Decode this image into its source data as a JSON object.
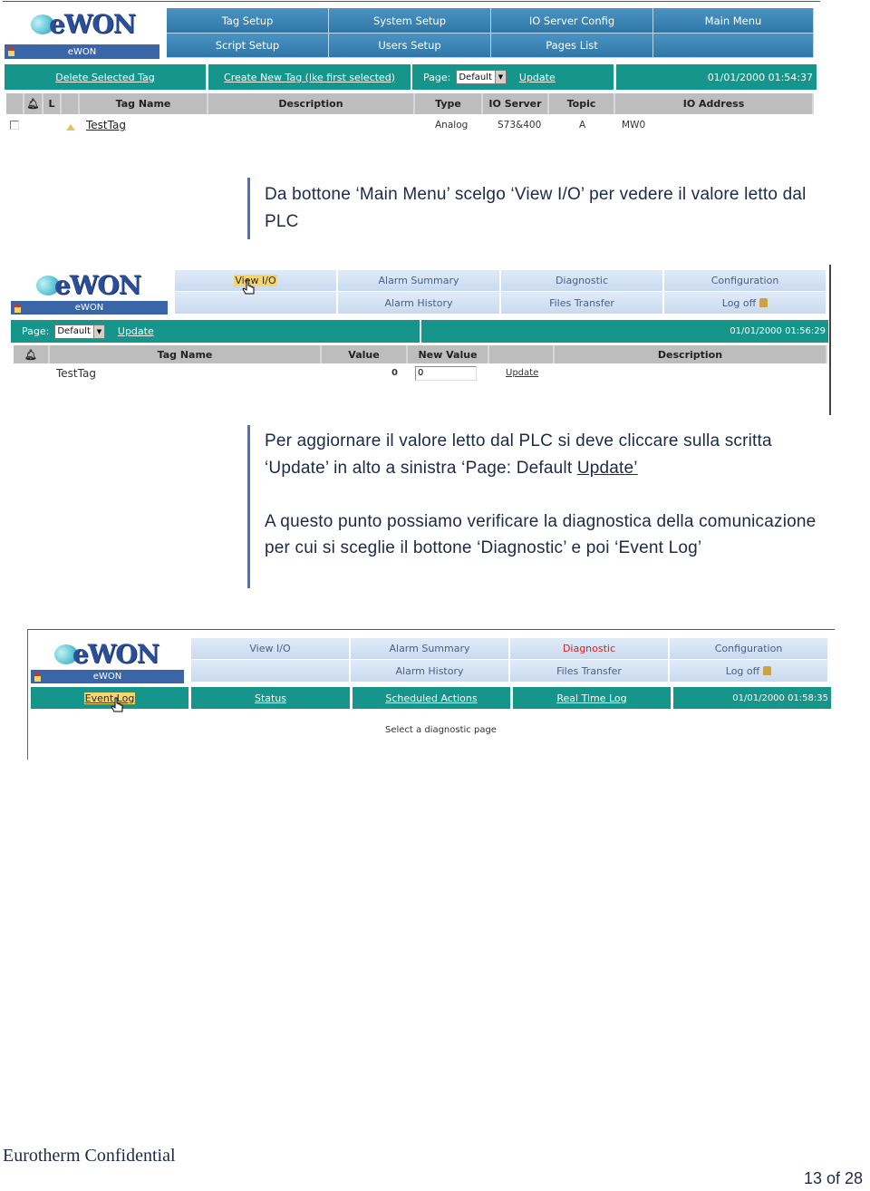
{
  "screenshot1": {
    "logo": "eWON",
    "device_name": "eWON",
    "nav_row1": [
      "Tag Setup",
      "System Setup",
      "IO Server Config",
      "Main Menu"
    ],
    "nav_row2": [
      "Script Setup",
      "Users Setup",
      "Pages List",
      ""
    ],
    "toolbar": {
      "delete_link": "Delete Selected Tag",
      "create_link": "Create New Tag (lke first selected)",
      "page_label": "Page:",
      "page_select": "Default",
      "update_link": "Update",
      "datetime": "01/01/2000 01:54:37"
    },
    "columns": [
      "",
      " ",
      "L",
      "",
      "Tag Name",
      "Description",
      "Type",
      "IO Server",
      "Topic",
      "IO Address"
    ],
    "rows": [
      {
        "tag_name": "TestTag",
        "description": "",
        "type": "Analog",
        "io_server": "S73&400",
        "topic": "A",
        "io_address": "MW0"
      }
    ]
  },
  "callout1": {
    "text": "Da bottone ‘Main Menu’ scelgo ‘View I/O’ per vedere il valore letto dal PLC"
  },
  "screenshot2": {
    "logo": "eWON",
    "device_name": "eWON",
    "nav_row1": [
      "View I/O",
      "Alarm Summary",
      "Diagnostic",
      "Configuration"
    ],
    "nav_row2": [
      "",
      "Alarm History",
      "Files Transfer",
      "Log off"
    ],
    "toolbar": {
      "page_label": "Page:",
      "page_select": "Default",
      "update_link": "Update",
      "datetime": "01/01/2000 01:56:29"
    },
    "columns": [
      "",
      "Tag Name",
      "Value",
      "New Value",
      "",
      "Description"
    ],
    "rows": [
      {
        "tag_name": "TestTag",
        "value": "0",
        "new_value": "0",
        "action": "Update",
        "description": ""
      }
    ]
  },
  "callout2": {
    "line1_a": "Per aggiornare il valore letto dal PLC si deve cliccare sulla scritta ‘Update’ in alto a sinistra ‘Page: Default ",
    "line1_link": "Update’",
    "para2": "A questo punto possiamo verificare la diagnostica della comunicazione per cui si sceglie il bottone ‘Diagnostic’ e poi ‘Event Log’"
  },
  "screenshot3": {
    "logo": "eWON",
    "device_name": "eWON",
    "nav_row1": [
      "View I/O",
      "Alarm Summary",
      "Diagnostic",
      "Configuration"
    ],
    "nav_row2": [
      "",
      "Alarm History",
      "Files Transfer",
      "Log off"
    ],
    "active_color": "#d32020",
    "submenu": [
      "Event Log",
      "Status",
      "Scheduled Actions",
      "Real Time Log"
    ],
    "datetime": "01/01/2000 01:58:35",
    "message": "Select a diagnostic page"
  },
  "footer": {
    "confidential": "Eurotherm Confidential",
    "page": "13 of 28"
  }
}
